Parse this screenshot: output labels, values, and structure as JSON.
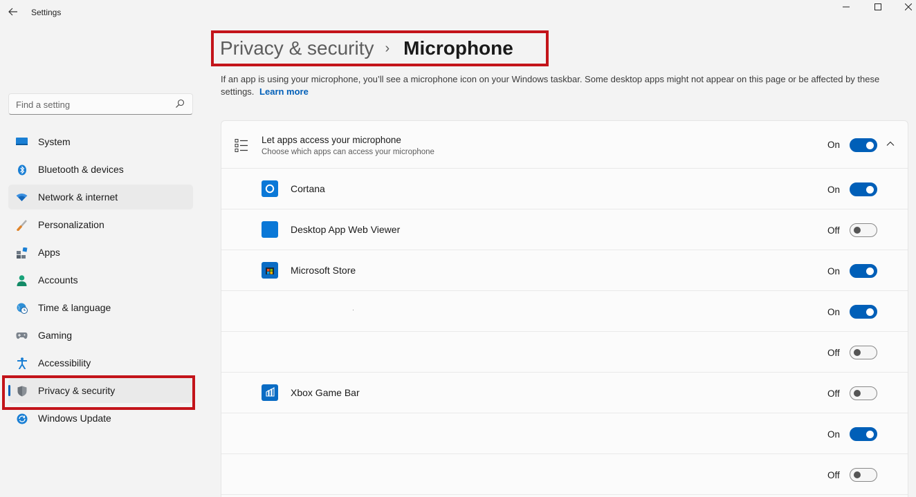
{
  "window": {
    "title": "Settings",
    "controls": [
      "minimize",
      "maximize",
      "close"
    ]
  },
  "search": {
    "placeholder": "Find a setting"
  },
  "sidebar": {
    "items": [
      {
        "label": "System",
        "icon": "system-icon",
        "state": "normal"
      },
      {
        "label": "Bluetooth & devices",
        "icon": "bluetooth-icon",
        "state": "normal"
      },
      {
        "label": "Network & internet",
        "icon": "wifi-icon",
        "state": "hover"
      },
      {
        "label": "Personalization",
        "icon": "brush-icon",
        "state": "normal"
      },
      {
        "label": "Apps",
        "icon": "apps-icon",
        "state": "normal"
      },
      {
        "label": "Accounts",
        "icon": "person-icon",
        "state": "normal"
      },
      {
        "label": "Time & language",
        "icon": "globe-clock-icon",
        "state": "normal"
      },
      {
        "label": "Gaming",
        "icon": "gamepad-icon",
        "state": "normal"
      },
      {
        "label": "Accessibility",
        "icon": "accessibility-icon",
        "state": "normal"
      },
      {
        "label": "Privacy & security",
        "icon": "shield-icon",
        "state": "selected"
      },
      {
        "label": "Windows Update",
        "icon": "update-icon",
        "state": "normal"
      }
    ]
  },
  "breadcrumb": {
    "parent": "Privacy & security",
    "separator": "›",
    "current": "Microphone"
  },
  "description": {
    "text": "If an app is using your microphone, you’ll see a microphone icon on your Windows taskbar. Some desktop apps might not appear on this page or be affected by these settings.",
    "link": "Learn more"
  },
  "master": {
    "title": "Let apps access your microphone",
    "subtitle": "Choose which apps can access your microphone",
    "state_label": "On",
    "on": true
  },
  "apps": [
    {
      "name": "Cortana",
      "icon": "cortana-icon",
      "state_label": "On",
      "on": true
    },
    {
      "name": "Desktop App Web Viewer",
      "icon": "webviewer-icon",
      "state_label": "Off",
      "on": false
    },
    {
      "name": "Microsoft Store",
      "icon": "store-icon",
      "state_label": "On",
      "on": true
    },
    {
      "name": "",
      "icon": "",
      "state_label": "On",
      "on": true
    },
    {
      "name": "",
      "icon": "",
      "state_label": "Off",
      "on": false
    },
    {
      "name": "Xbox Game Bar",
      "icon": "xbox-game-bar-icon",
      "state_label": "Off",
      "on": false
    },
    {
      "name": "",
      "icon": "",
      "state_label": "On",
      "on": true
    },
    {
      "name": "",
      "icon": "",
      "state_label": "Off",
      "on": false
    }
  ],
  "colors": {
    "accent": "#005fb8",
    "highlight_box": "#c3141a",
    "background": "#f3f3f3"
  }
}
